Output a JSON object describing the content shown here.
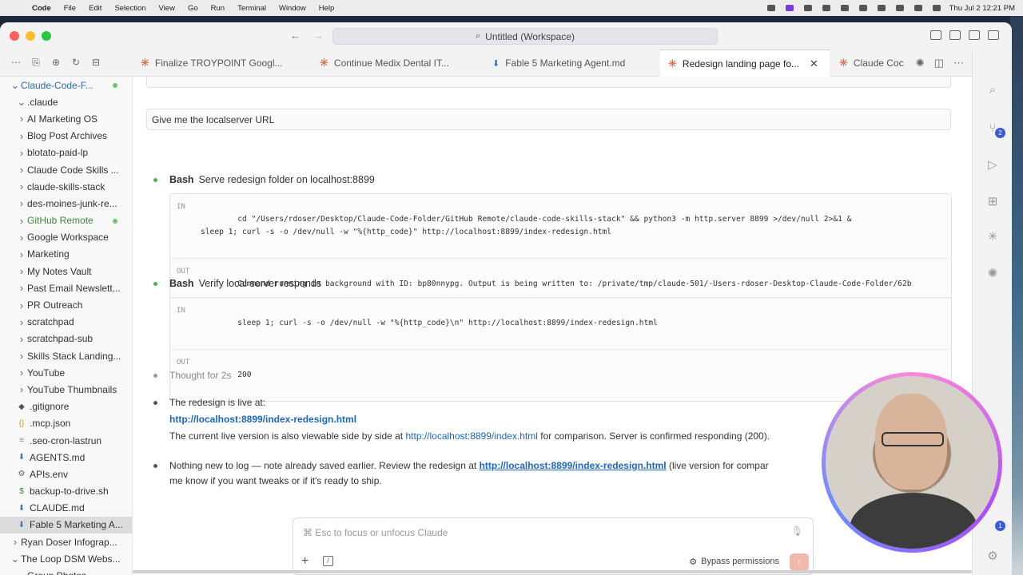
{
  "menubar": {
    "app": "Code",
    "items": [
      "File",
      "Edit",
      "Selection",
      "View",
      "Go",
      "Run",
      "Terminal",
      "Window",
      "Help"
    ],
    "clock": "Thu Jul 2  12:21 PM"
  },
  "window": {
    "title": "Untitled (Workspace)"
  },
  "tabs": [
    {
      "label": "Finalize TROYPOINT Googl...",
      "icon": "claude-asterisk-icon"
    },
    {
      "label": "Continue Medix Dental IT...",
      "icon": "claude-asterisk-icon"
    },
    {
      "label": "Fable 5 Marketing Agent.md",
      "icon": "markdown-icon"
    },
    {
      "label": "Redesign landing page fo...",
      "icon": "claude-asterisk-icon",
      "active": true
    },
    {
      "label": "Claude Coc",
      "icon": "claude-asterisk-icon"
    }
  ],
  "sidebar": {
    "items": [
      {
        "label": "Claude-Code-F...",
        "chev": "v",
        "indent": 0,
        "root": true
      },
      {
        "label": ".claude",
        "chev": "v",
        "indent": 1
      },
      {
        "label": "AI Marketing OS",
        "chev": ">",
        "indent": 1
      },
      {
        "label": "Blog Post Archives",
        "chev": ">",
        "indent": 1
      },
      {
        "label": "blotato-paid-lp",
        "chev": ">",
        "indent": 1
      },
      {
        "label": "Claude Code Skills ...",
        "chev": ">",
        "indent": 1
      },
      {
        "label": "claude-skills-stack",
        "chev": ">",
        "indent": 1
      },
      {
        "label": "des-moines-junk-re...",
        "chev": ">",
        "indent": 1
      },
      {
        "label": "GitHub Remote",
        "chev": ">",
        "indent": 1,
        "green": true
      },
      {
        "label": "Google Workspace",
        "chev": ">",
        "indent": 1
      },
      {
        "label": "Marketing",
        "chev": ">",
        "indent": 1
      },
      {
        "label": "My Notes Vault",
        "chev": ">",
        "indent": 1
      },
      {
        "label": "Past Email Newslett...",
        "chev": ">",
        "indent": 1
      },
      {
        "label": "PR Outreach",
        "chev": ">",
        "indent": 1
      },
      {
        "label": "scratchpad",
        "chev": ">",
        "indent": 1
      },
      {
        "label": "scratchpad-sub",
        "chev": ">",
        "indent": 1
      },
      {
        "label": "Skills Stack Landing...",
        "chev": ">",
        "indent": 1
      },
      {
        "label": "YouTube",
        "chev": ">",
        "indent": 1
      },
      {
        "label": "YouTube Thumbnails",
        "chev": ">",
        "indent": 1
      },
      {
        "label": ".gitignore",
        "file": "◆",
        "color": "#555",
        "indent": 1
      },
      {
        "label": ".mcp.json",
        "file": "{}",
        "color": "#c9a227",
        "indent": 1
      },
      {
        "label": ".seo-cron-lastrun",
        "file": "≡",
        "color": "#888",
        "indent": 1
      },
      {
        "label": "AGENTS.md",
        "file": "⬇",
        "color": "#3478c6",
        "indent": 1
      },
      {
        "label": "APIs.env",
        "file": "⚙",
        "color": "#666",
        "indent": 1
      },
      {
        "label": "backup-to-drive.sh",
        "file": "$",
        "color": "#3a8a3a",
        "indent": 1
      },
      {
        "label": "CLAUDE.md",
        "file": "⬇",
        "color": "#3478c6",
        "indent": 1
      },
      {
        "label": "Fable 5 Marketing A...",
        "file": "⬇",
        "color": "#3478c6",
        "indent": 1,
        "selected": true
      },
      {
        "label": "Ryan Doser Infograp...",
        "chev": ">",
        "indent": 0
      },
      {
        "label": "The Loop DSM Webs...",
        "chev": "v",
        "indent": 0
      },
      {
        "label": "Group Photos",
        "chev": "",
        "indent": 1
      }
    ]
  },
  "conversation": {
    "user_prompt": "Give me the localserver URL",
    "step1": {
      "tool": "Bash",
      "desc": "Serve redesign folder on localhost:8899",
      "in_tag": "IN",
      "in_line1": "cd \"/Users/rdoser/Desktop/Claude-Code-Folder/GitHub Remote/claude-code-skills-stack\" && python3 -m http.server 8899 >/dev/null 2>&1 &",
      "in_line2": "sleep 1; curl -s -o /dev/null -w \"%{http_code}\" http://localhost:8899/index-redesign.html",
      "out_tag": "OUT",
      "out": "Command running in background with ID: bp80nnypg. Output is being written to: /private/tmp/claude-501/-Users-rdoser-Desktop-Claude-Code-Folder/62b"
    },
    "step2": {
      "tool": "Bash",
      "desc": "Verify local server responds",
      "in_tag": "IN",
      "in_line1": "sleep 1; curl -s -o /dev/null -w \"%{http_code}\\n\" http://localhost:8899/index-redesign.html",
      "out_tag": "OUT",
      "out": "200"
    },
    "thought": "Thought for 2s",
    "reply1": {
      "lead": "The redesign is live at:",
      "url": "http://localhost:8899/index-redesign.html",
      "line2_pre": "The current live version is also viewable side by side at ",
      "line2_url": "http://localhost:8899/index.html",
      "line2_post": " for comparison. Server is confirmed responding (200)."
    },
    "reply2": {
      "pre": "Nothing new to log — note already saved earlier. Review the redesign at ",
      "url": "http://localhost:8899/index-redesign.html",
      "post": " (live version for compar",
      "line2": "me know if you want tweaks or if it's ready to ship."
    }
  },
  "input": {
    "placeholder": "⌘ Esc to focus or unfocus Claude",
    "bypass_label": "Bypass permissions"
  },
  "rail": {
    "scm_badge": "2",
    "account_badge": "1"
  }
}
